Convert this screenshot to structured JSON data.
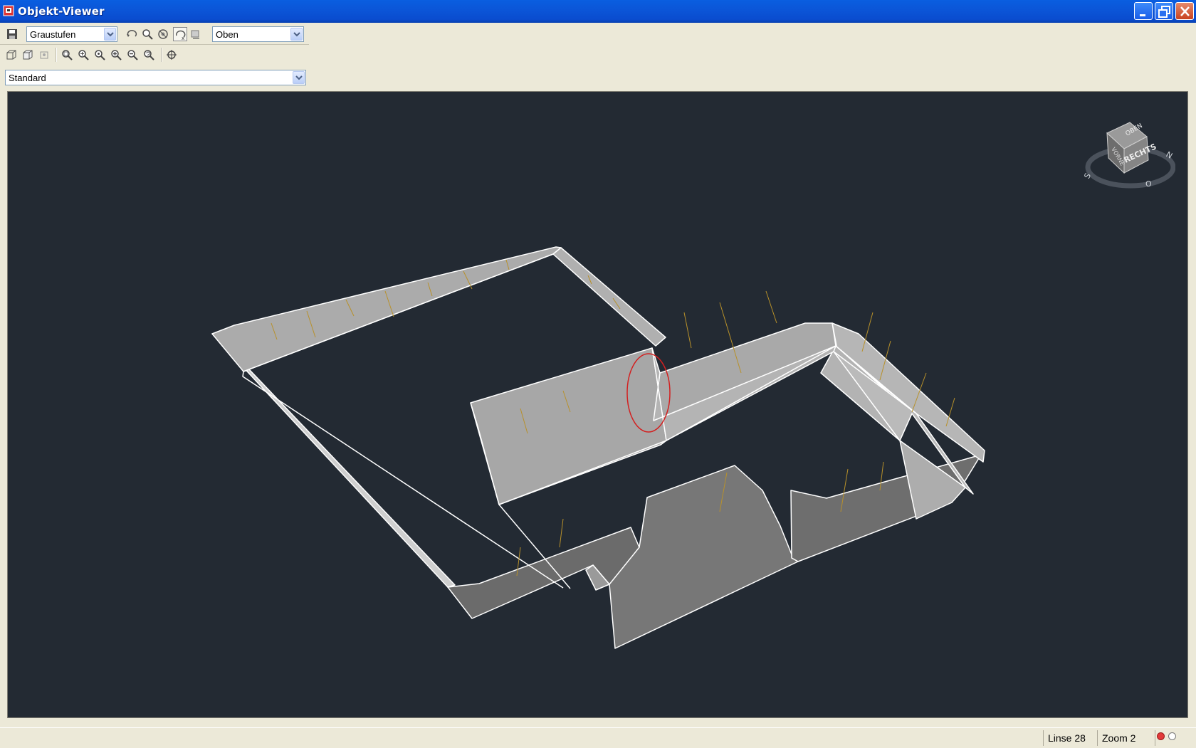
{
  "window": {
    "title": "Objekt-Viewer",
    "accent": "#0b56d8",
    "controls": {
      "minimize": "minimize-icon",
      "maximize": "restore-icon",
      "close": "close-icon"
    }
  },
  "toolbar": {
    "visual_style": "Graustufen",
    "view_direction": "Oben",
    "named_view": "Standard",
    "icons_row1": [
      "save-icon",
      "orbit-icon",
      "pan-icon",
      "zoom-extents-icon",
      "free-orbit-icon",
      "camera-icon"
    ],
    "icons_row2": [
      "wireframe-cube-icon",
      "shaded-cube-icon",
      "camera-view-icon",
      "zoom-window-icon",
      "zoom-realtime-icon",
      "zoom-all-icon",
      "zoom-in-icon",
      "zoom-out-icon",
      "zoom-previous-icon",
      "target-icon"
    ]
  },
  "viewport": {
    "background": "#232a33",
    "viewcube": {
      "face_top": "OBEN",
      "face_right": "RECHTS",
      "face_left": "VORNE",
      "compass": {
        "north": "N",
        "south": "S",
        "east": "O"
      }
    }
  },
  "status": {
    "line": "Linse 28",
    "zoom": "Zoom 2"
  }
}
